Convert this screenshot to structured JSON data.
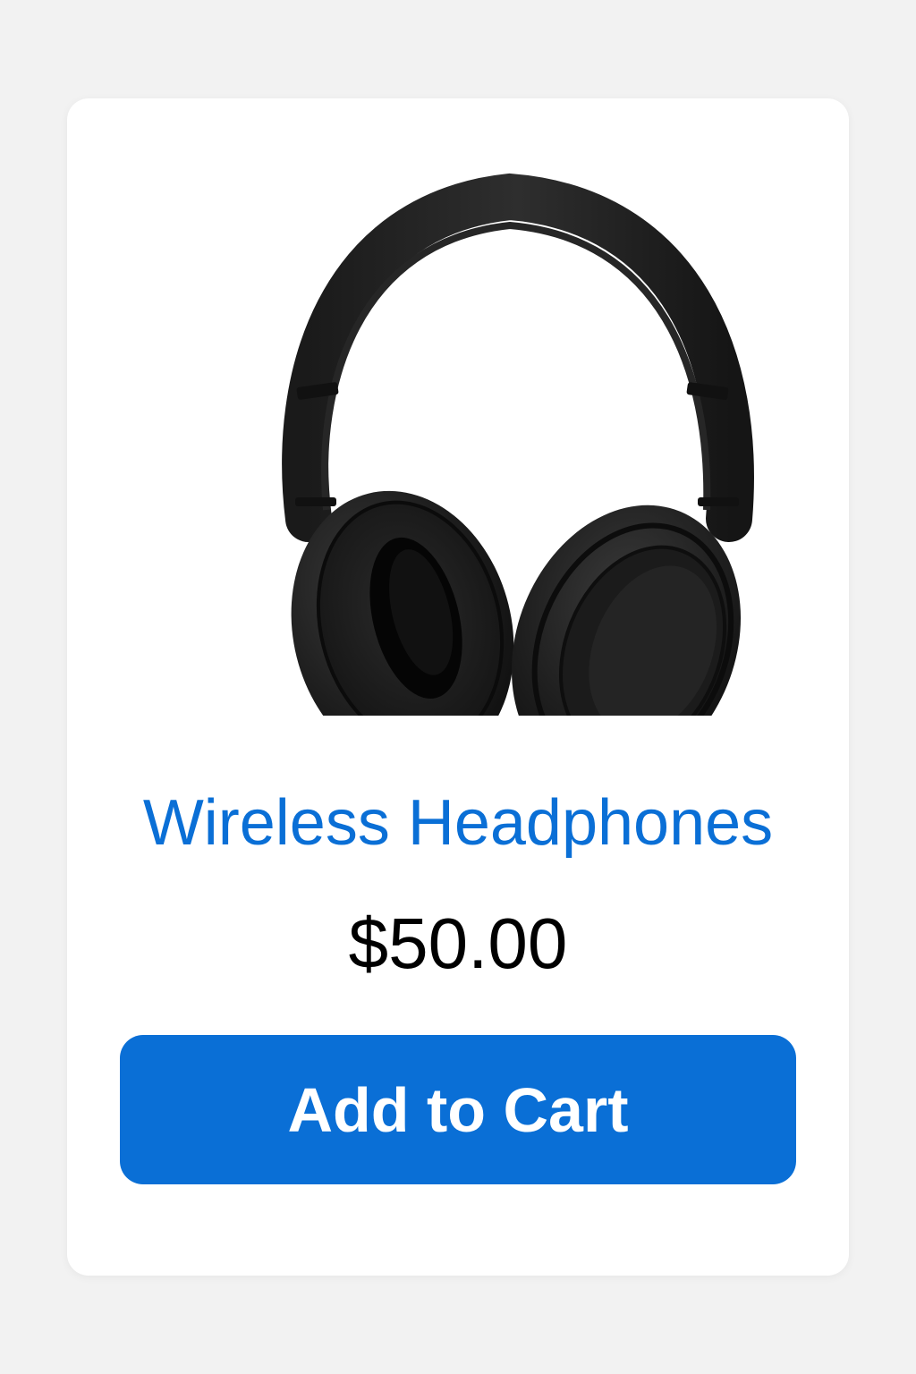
{
  "product": {
    "name": "Wireless Headphones",
    "price": "$50.00",
    "image_icon": "headphones-icon",
    "add_to_cart_label": "Add to Cart"
  },
  "colors": {
    "page_background": "#f2f2f2",
    "card_background": "#ffffff",
    "accent": "#0a6fd6",
    "price_text": "#000000",
    "button_text": "#ffffff"
  }
}
